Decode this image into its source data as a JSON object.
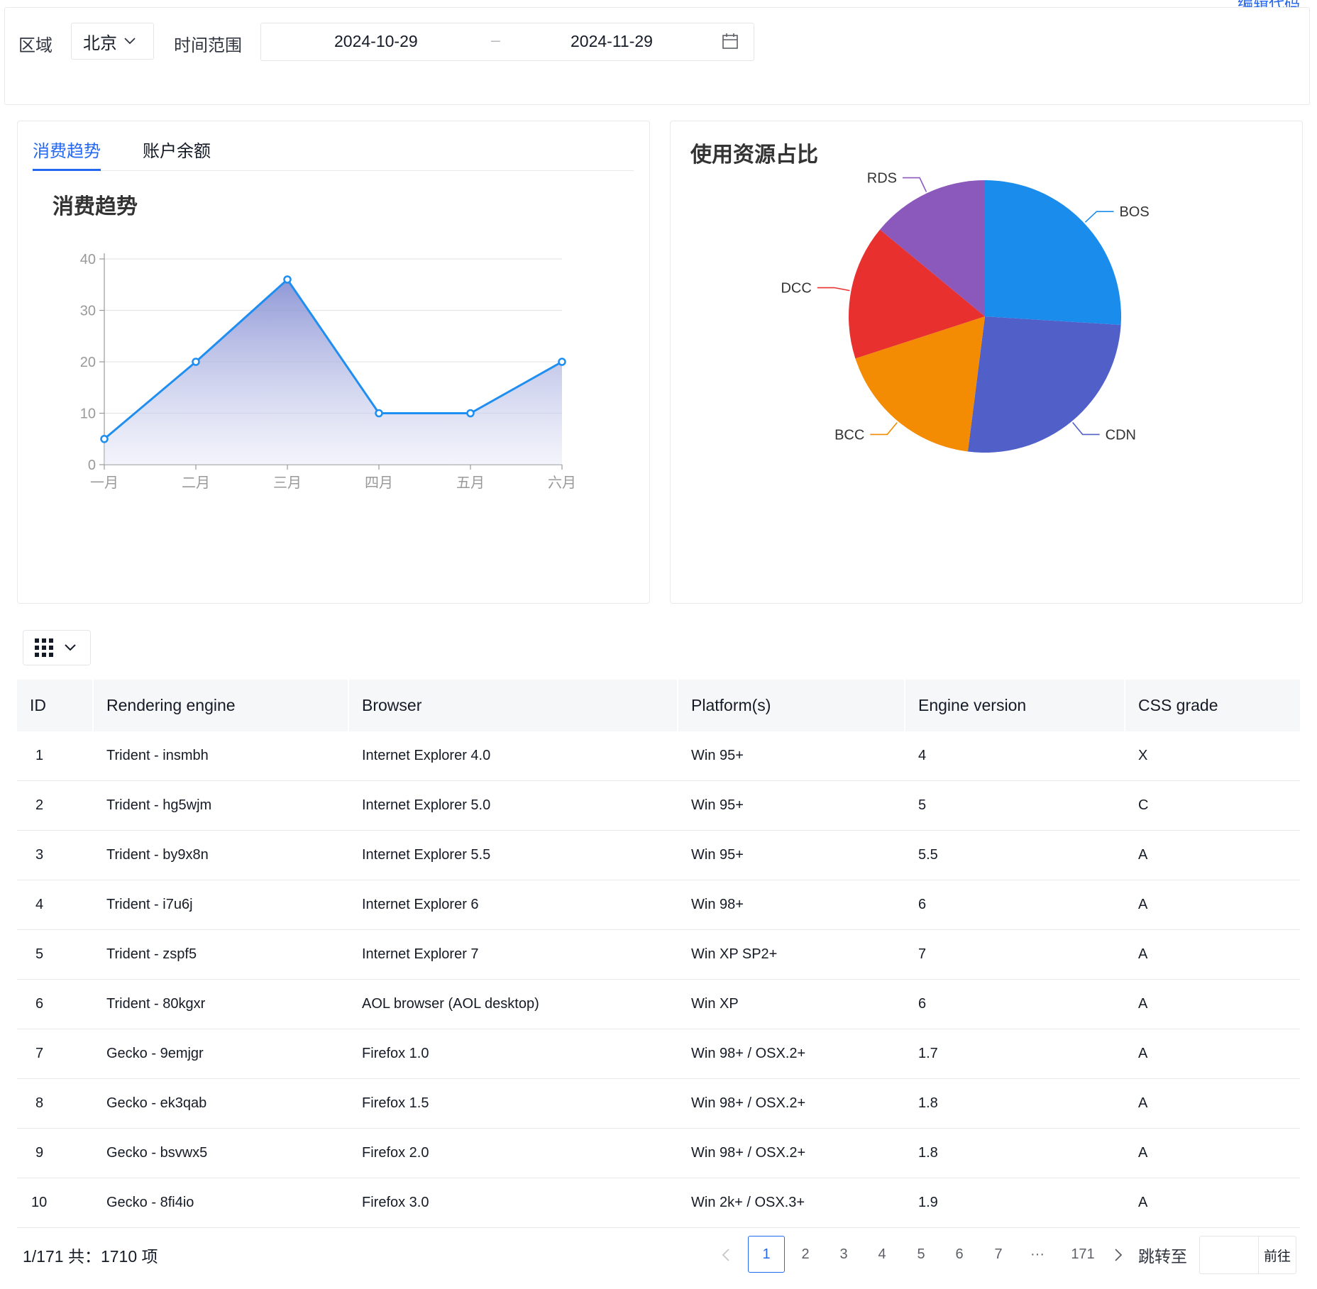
{
  "top_link": "编辑代码",
  "filter": {
    "region_label": "区域",
    "region_value": "北京",
    "time_label": "时间范围",
    "date_start": "2024-10-29",
    "date_sep": "–",
    "date_end": "2024-11-29"
  },
  "tabs": [
    "消费趋势",
    "账户余额"
  ],
  "colors": {
    "accent": "#2468f2",
    "line": "#1f8ef1"
  },
  "chart_data": [
    {
      "type": "area",
      "title": "消费趋势",
      "categories": [
        "一月",
        "二月",
        "三月",
        "四月",
        "五月",
        "六月"
      ],
      "values": [
        5,
        20,
        36,
        10,
        10,
        20
      ],
      "ylim": [
        0,
        40
      ],
      "yticks": [
        0,
        10,
        20,
        30,
        40
      ],
      "xlabel": "",
      "ylabel": "",
      "grid": true
    },
    {
      "type": "pie",
      "title": "使用资源占比",
      "labels": [
        "BOS",
        "CDN",
        "BCC",
        "DCC",
        "RDS"
      ],
      "values": [
        26,
        26,
        18,
        16,
        14
      ],
      "colors": [
        "#1a8cec",
        "#515fc8",
        "#f38c03",
        "#e8302e",
        "#8b58bc"
      ]
    }
  ],
  "table": {
    "column_button_icon": "grid-icon",
    "headers": [
      "ID",
      "Rendering engine",
      "Browser",
      "Platform(s)",
      "Engine version",
      "CSS grade"
    ],
    "rows": [
      [
        "1",
        "Trident - insmbh",
        "Internet Explorer 4.0",
        "Win 95+",
        "4",
        "X"
      ],
      [
        "2",
        "Trident - hg5wjm",
        "Internet Explorer 5.0",
        "Win 95+",
        "5",
        "C"
      ],
      [
        "3",
        "Trident - by9x8n",
        "Internet Explorer 5.5",
        "Win 95+",
        "5.5",
        "A"
      ],
      [
        "4",
        "Trident - i7u6j",
        "Internet Explorer 6",
        "Win 98+",
        "6",
        "A"
      ],
      [
        "5",
        "Trident - zspf5",
        "Internet Explorer 7",
        "Win XP SP2+",
        "7",
        "A"
      ],
      [
        "6",
        "Trident - 80kgxr",
        "AOL browser (AOL desktop)",
        "Win XP",
        "6",
        "A"
      ],
      [
        "7",
        "Gecko - 9emjgr",
        "Firefox 1.0",
        "Win 98+ / OSX.2+",
        "1.7",
        "A"
      ],
      [
        "8",
        "Gecko - ek3qab",
        "Firefox 1.5",
        "Win 98+ / OSX.2+",
        "1.8",
        "A"
      ],
      [
        "9",
        "Gecko - bsvwx5",
        "Firefox 2.0",
        "Win 98+ / OSX.2+",
        "1.8",
        "A"
      ],
      [
        "10",
        "Gecko - 8fi4io",
        "Firefox 3.0",
        "Win 2k+ / OSX.3+",
        "1.9",
        "A"
      ]
    ]
  },
  "pagination": {
    "info": "1/171 共：1710 项",
    "pages": [
      "1",
      "2",
      "3",
      "4",
      "5",
      "6",
      "7",
      "···",
      "171"
    ],
    "current": "1",
    "jump_label": "跳转至",
    "go_label": "前往"
  }
}
